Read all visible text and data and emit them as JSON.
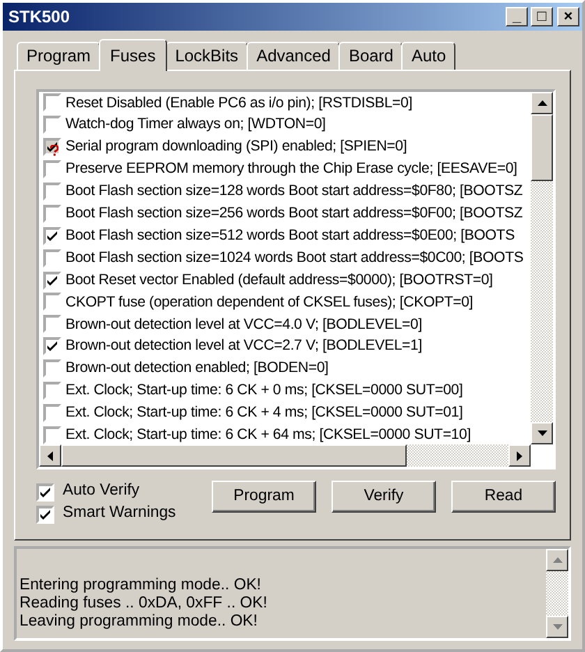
{
  "window": {
    "title": "STK500",
    "controls": [
      "_",
      "□",
      "×"
    ]
  },
  "tabs": [
    {
      "label": "Program",
      "selected": false
    },
    {
      "label": "Fuses",
      "selected": true
    },
    {
      "label": "LockBits",
      "selected": false
    },
    {
      "label": "Advanced",
      "selected": false
    },
    {
      "label": "Board",
      "selected": false
    },
    {
      "label": "Auto",
      "selected": false
    }
  ],
  "fuses": [
    {
      "label": "Reset Disabled (Enable PC6 as i/o pin); [RSTDISBL=0]",
      "checked": false,
      "flagged": false
    },
    {
      "label": "Watch-dog Timer always on; [WDTON=0]",
      "checked": false,
      "flagged": false
    },
    {
      "label": "Serial program downloading (SPI) enabled; [SPIEN=0]",
      "checked": true,
      "flagged": true
    },
    {
      "label": "Preserve EEPROM memory through the Chip Erase cycle; [EESAVE=0]",
      "checked": false,
      "flagged": false
    },
    {
      "label": "Boot Flash section size=128 words Boot start address=$0F80; [BOOTSZ",
      "checked": false,
      "flagged": false
    },
    {
      "label": "Boot Flash section size=256 words Boot start address=$0F00; [BOOTSZ",
      "checked": false,
      "flagged": false
    },
    {
      "label": "Boot Flash section size=512 words Boot start address=$0E00; [BOOTS",
      "checked": true,
      "flagged": false
    },
    {
      "label": "Boot Flash section size=1024 words Boot start address=$0C00; [BOOTS",
      "checked": false,
      "flagged": false
    },
    {
      "label": "Boot Reset vector Enabled (default address=$0000); [BOOTRST=0]",
      "checked": true,
      "flagged": false
    },
    {
      "label": "CKOPT fuse (operation dependent of CKSEL fuses); [CKOPT=0]",
      "checked": false,
      "flagged": false
    },
    {
      "label": "Brown-out detection level at VCC=4.0 V; [BODLEVEL=0]",
      "checked": false,
      "flagged": false
    },
    {
      "label": "Brown-out detection level at VCC=2.7 V; [BODLEVEL=1]",
      "checked": true,
      "flagged": false
    },
    {
      "label": "Brown-out detection enabled; [BODEN=0]",
      "checked": false,
      "flagged": false
    },
    {
      "label": "Ext. Clock; Start-up time: 6 CK + 0 ms; [CKSEL=0000 SUT=00]",
      "checked": false,
      "flagged": false
    },
    {
      "label": "Ext. Clock; Start-up time: 6 CK + 4 ms; [CKSEL=0000 SUT=01]",
      "checked": false,
      "flagged": false
    },
    {
      "label": "Ext. Clock; Start-up time: 6 CK + 64 ms; [CKSEL=0000 SUT=10]",
      "checked": false,
      "flagged": false
    }
  ],
  "options": [
    {
      "label": "Auto Verify",
      "checked": true
    },
    {
      "label": "Smart Warnings",
      "checked": true
    }
  ],
  "buttons": [
    "Program",
    "Verify",
    "Read"
  ],
  "log": [
    "Entering programming mode.. OK!",
    "Reading fuses .. 0xDA, 0xFF .. OK!",
    "Leaving programming mode.. OK!"
  ]
}
